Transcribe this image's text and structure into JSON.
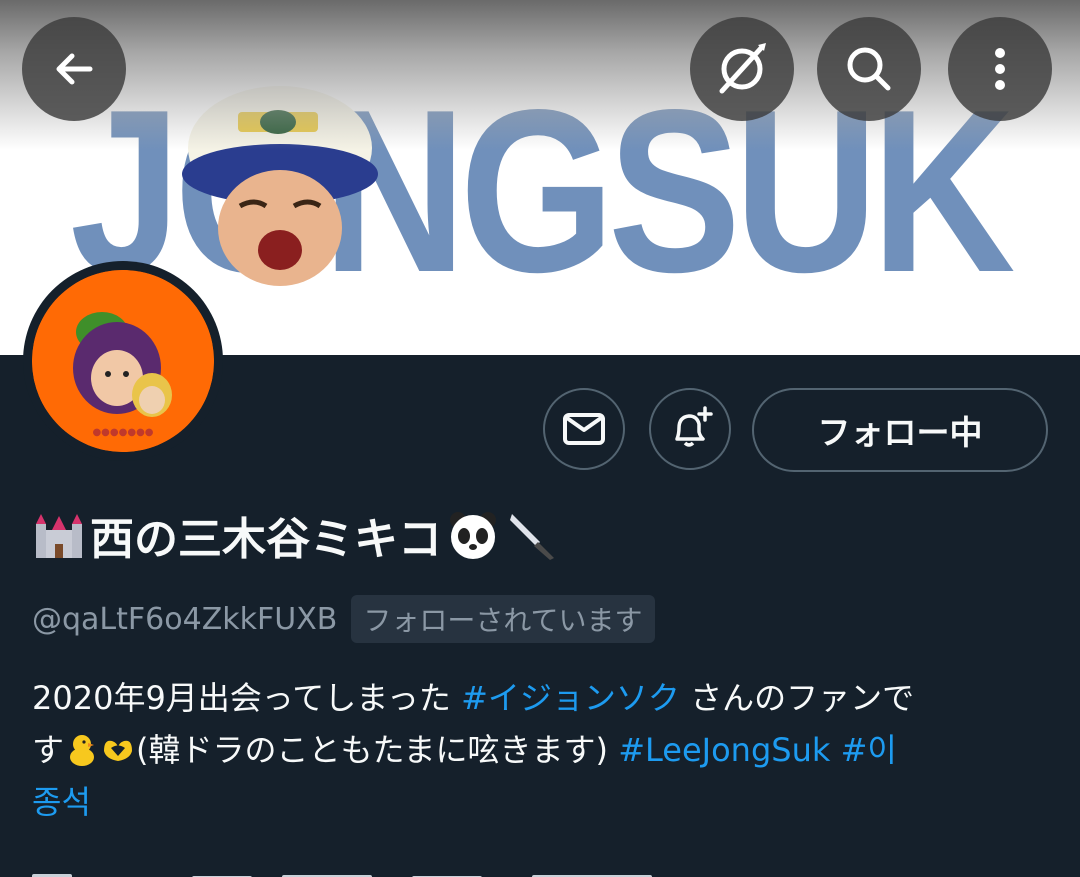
{
  "banner": {
    "text": "JONGSUK"
  },
  "top_bar": {
    "back_icon": "arrow-left-icon",
    "mute_icon": "notifications-off-icon",
    "search_icon": "search-icon",
    "more_icon": "more-vertical-icon"
  },
  "actions": {
    "message_icon": "mail-icon",
    "notify_icon": "bell-plus-icon",
    "follow_label": "フォロー中"
  },
  "profile": {
    "display_name": "西の三木谷ミキコ",
    "name_emojis": [
      "castle-emoji",
      "panda-emoji",
      "knife-emoji"
    ],
    "handle": "@qaLtF6o4ZkkFUXB",
    "follows_you": "フォローされています"
  },
  "bio": {
    "line1_text": "2020年9月出会ってしまった ",
    "tag1": "#イジョンソク",
    "line1_tail": " さんのファンで",
    "line2_head": "す",
    "line2_text": "(韓ドラのこともたまに呟きます) ",
    "tag2": "#LeeJongSuk",
    "tag3_part1": " #이",
    "tag3_part2": "종석"
  },
  "colors": {
    "background": "#15202b",
    "link": "#1d9bf0",
    "muted": "#8b98a5",
    "banner_text": "#7090bb",
    "avatar_bg": "#ff6a05"
  }
}
